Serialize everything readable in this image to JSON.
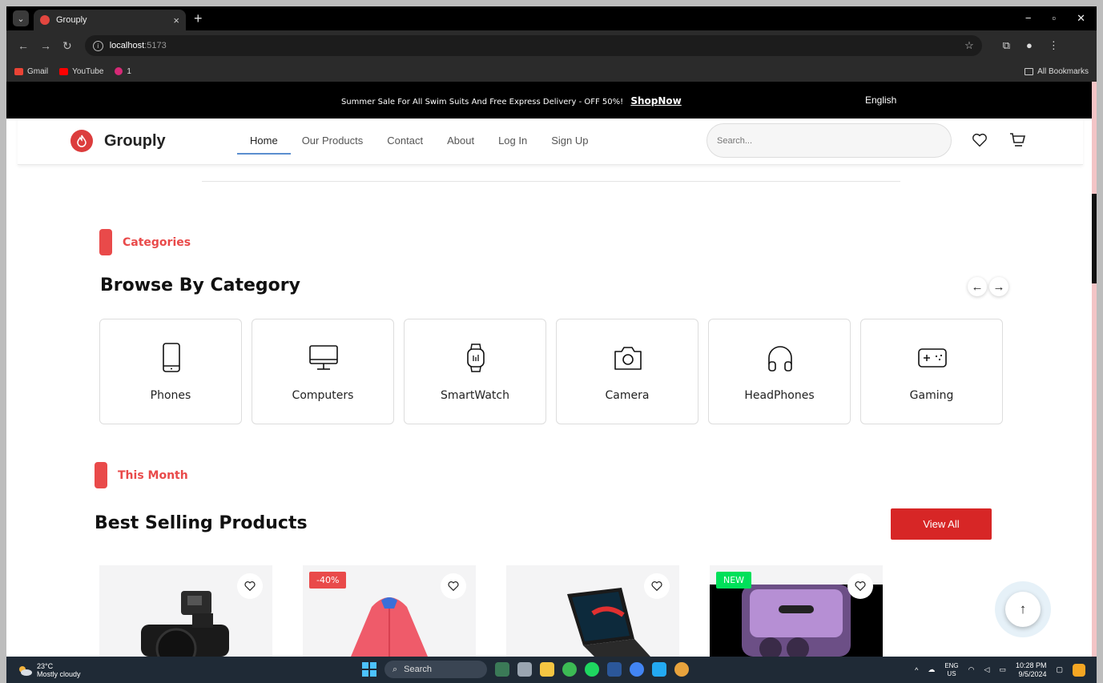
{
  "browser": {
    "tab_title": "Grouply",
    "url_host": "localhost",
    "url_port": ":5173",
    "bookmarks": [
      {
        "label": "Gmail",
        "color": "#ea4335"
      },
      {
        "label": "YouTube",
        "color": "#ff0000"
      },
      {
        "label": "1",
        "color": "#d62976"
      }
    ],
    "all_bookmarks": "All Bookmarks"
  },
  "topbar": {
    "promo": "Summer Sale For All Swim Suits And Free Express Delivery - OFF 50%!",
    "shop_now": "ShopNow",
    "language": "English"
  },
  "header": {
    "logo": "Grouply",
    "nav": [
      "Home",
      "Our Products",
      "Contact",
      "About",
      "Log In",
      "Sign Up"
    ],
    "search_placeholder": "Search..."
  },
  "categories_section": {
    "tag": "Categories",
    "title": "Browse By Category",
    "prev_arrow": "←",
    "next_arrow": "→",
    "items": [
      {
        "label": "Phones",
        "icon": "phone-icon"
      },
      {
        "label": "Computers",
        "icon": "computer-icon"
      },
      {
        "label": "SmartWatch",
        "icon": "smartwatch-icon"
      },
      {
        "label": "Camera",
        "icon": "camera-icon"
      },
      {
        "label": "HeadPhones",
        "icon": "headphones-icon"
      },
      {
        "label": "Gaming",
        "icon": "gamepad-icon"
      }
    ]
  },
  "best_selling": {
    "tag": "This Month",
    "title": "Best Selling Products",
    "view_all": "View All",
    "badges": {
      "discount": "-40%",
      "new": "NEW"
    }
  },
  "scroll_top": "↑",
  "taskbar": {
    "temp": "23°C",
    "weather": "Mostly cloudy",
    "search": "Search",
    "lang_top": "ENG",
    "lang_bottom": "US",
    "time": "10:28 PM",
    "date": "9/5/2024"
  },
  "colors": {
    "accent": "#e94a4a",
    "button": "#d72626",
    "new_badge": "#00e05a"
  }
}
